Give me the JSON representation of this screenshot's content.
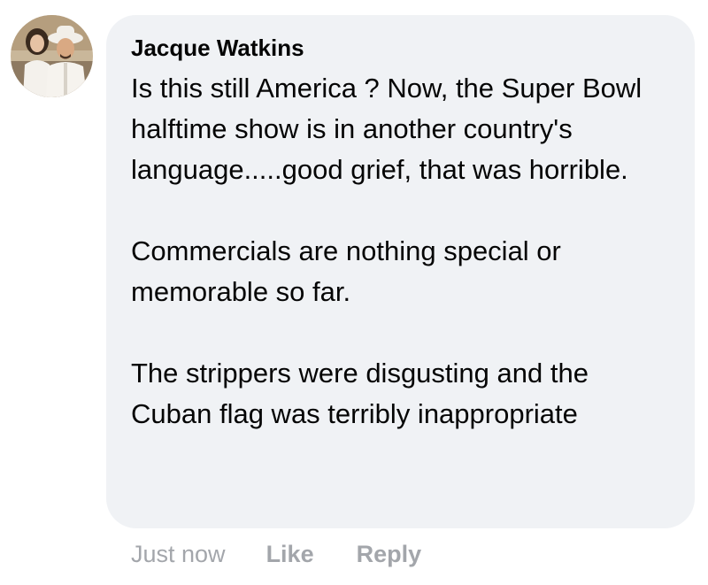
{
  "comment": {
    "author": "Jacque Watkins",
    "paragraphs": [
      "Is this still America ? Now, the Super Bowl halftime show is in another country's language.....good grief, that was horrible.",
      "Commercials are nothing special or memorable so far.",
      "The strippers were disgusting and the Cuban flag was terribly inappropriate"
    ],
    "timestamp": "Just now",
    "like_label": "Like",
    "reply_label": "Reply"
  },
  "colors": {
    "bubble_bg": "#f0f2f5",
    "text": "#050505",
    "meta": "#a3a6ab"
  },
  "icons": {
    "avatar": "profile-photo"
  }
}
